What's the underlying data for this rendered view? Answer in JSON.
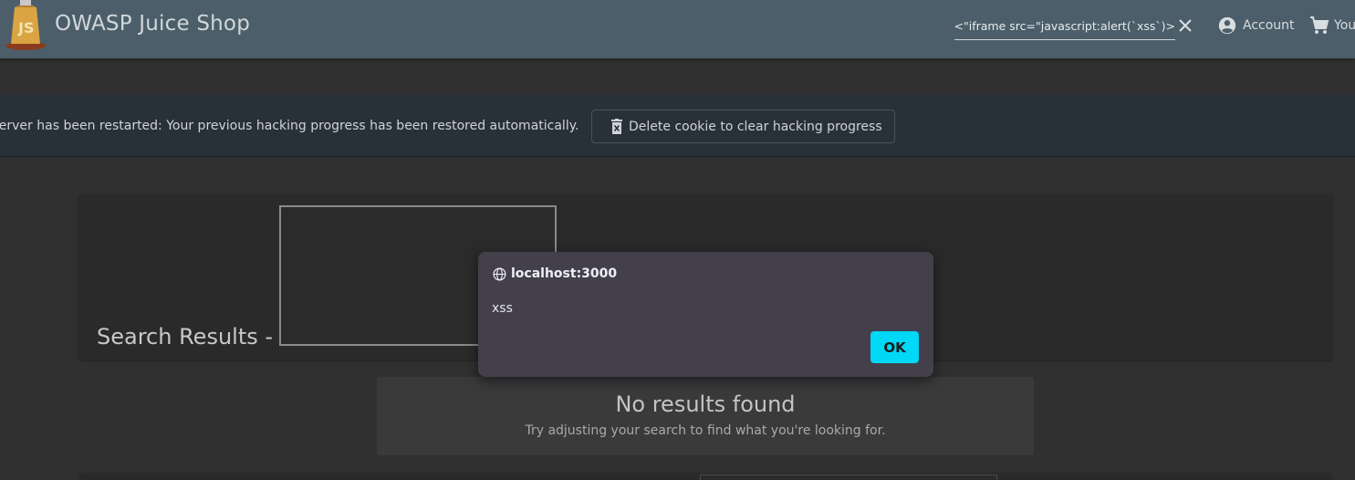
{
  "header": {
    "title": "OWASP Juice Shop",
    "logo_letters": "JS",
    "search_value": "<iframe src=\"javascript:alert(`xss`)\">",
    "account_label": "Account",
    "basket_label": "Your Basket"
  },
  "banner": {
    "message": "The server has been restarted: Your previous hacking progress has been restored automatically.",
    "delete_cookie_label": "Delete cookie to clear hacking progress"
  },
  "results": {
    "title": "Search Results -"
  },
  "no_results": {
    "title": "No results found",
    "subtitle": "Try adjusting your search to find what you're looking for."
  },
  "alert": {
    "origin": "localhost:3000",
    "message": "xss",
    "ok_label": "OK"
  },
  "colors": {
    "toolbar": "#4b5e69",
    "background": "#303030",
    "banner": "#28303a",
    "dialog": "#43404c",
    "ok_button": "#00d8f5"
  }
}
